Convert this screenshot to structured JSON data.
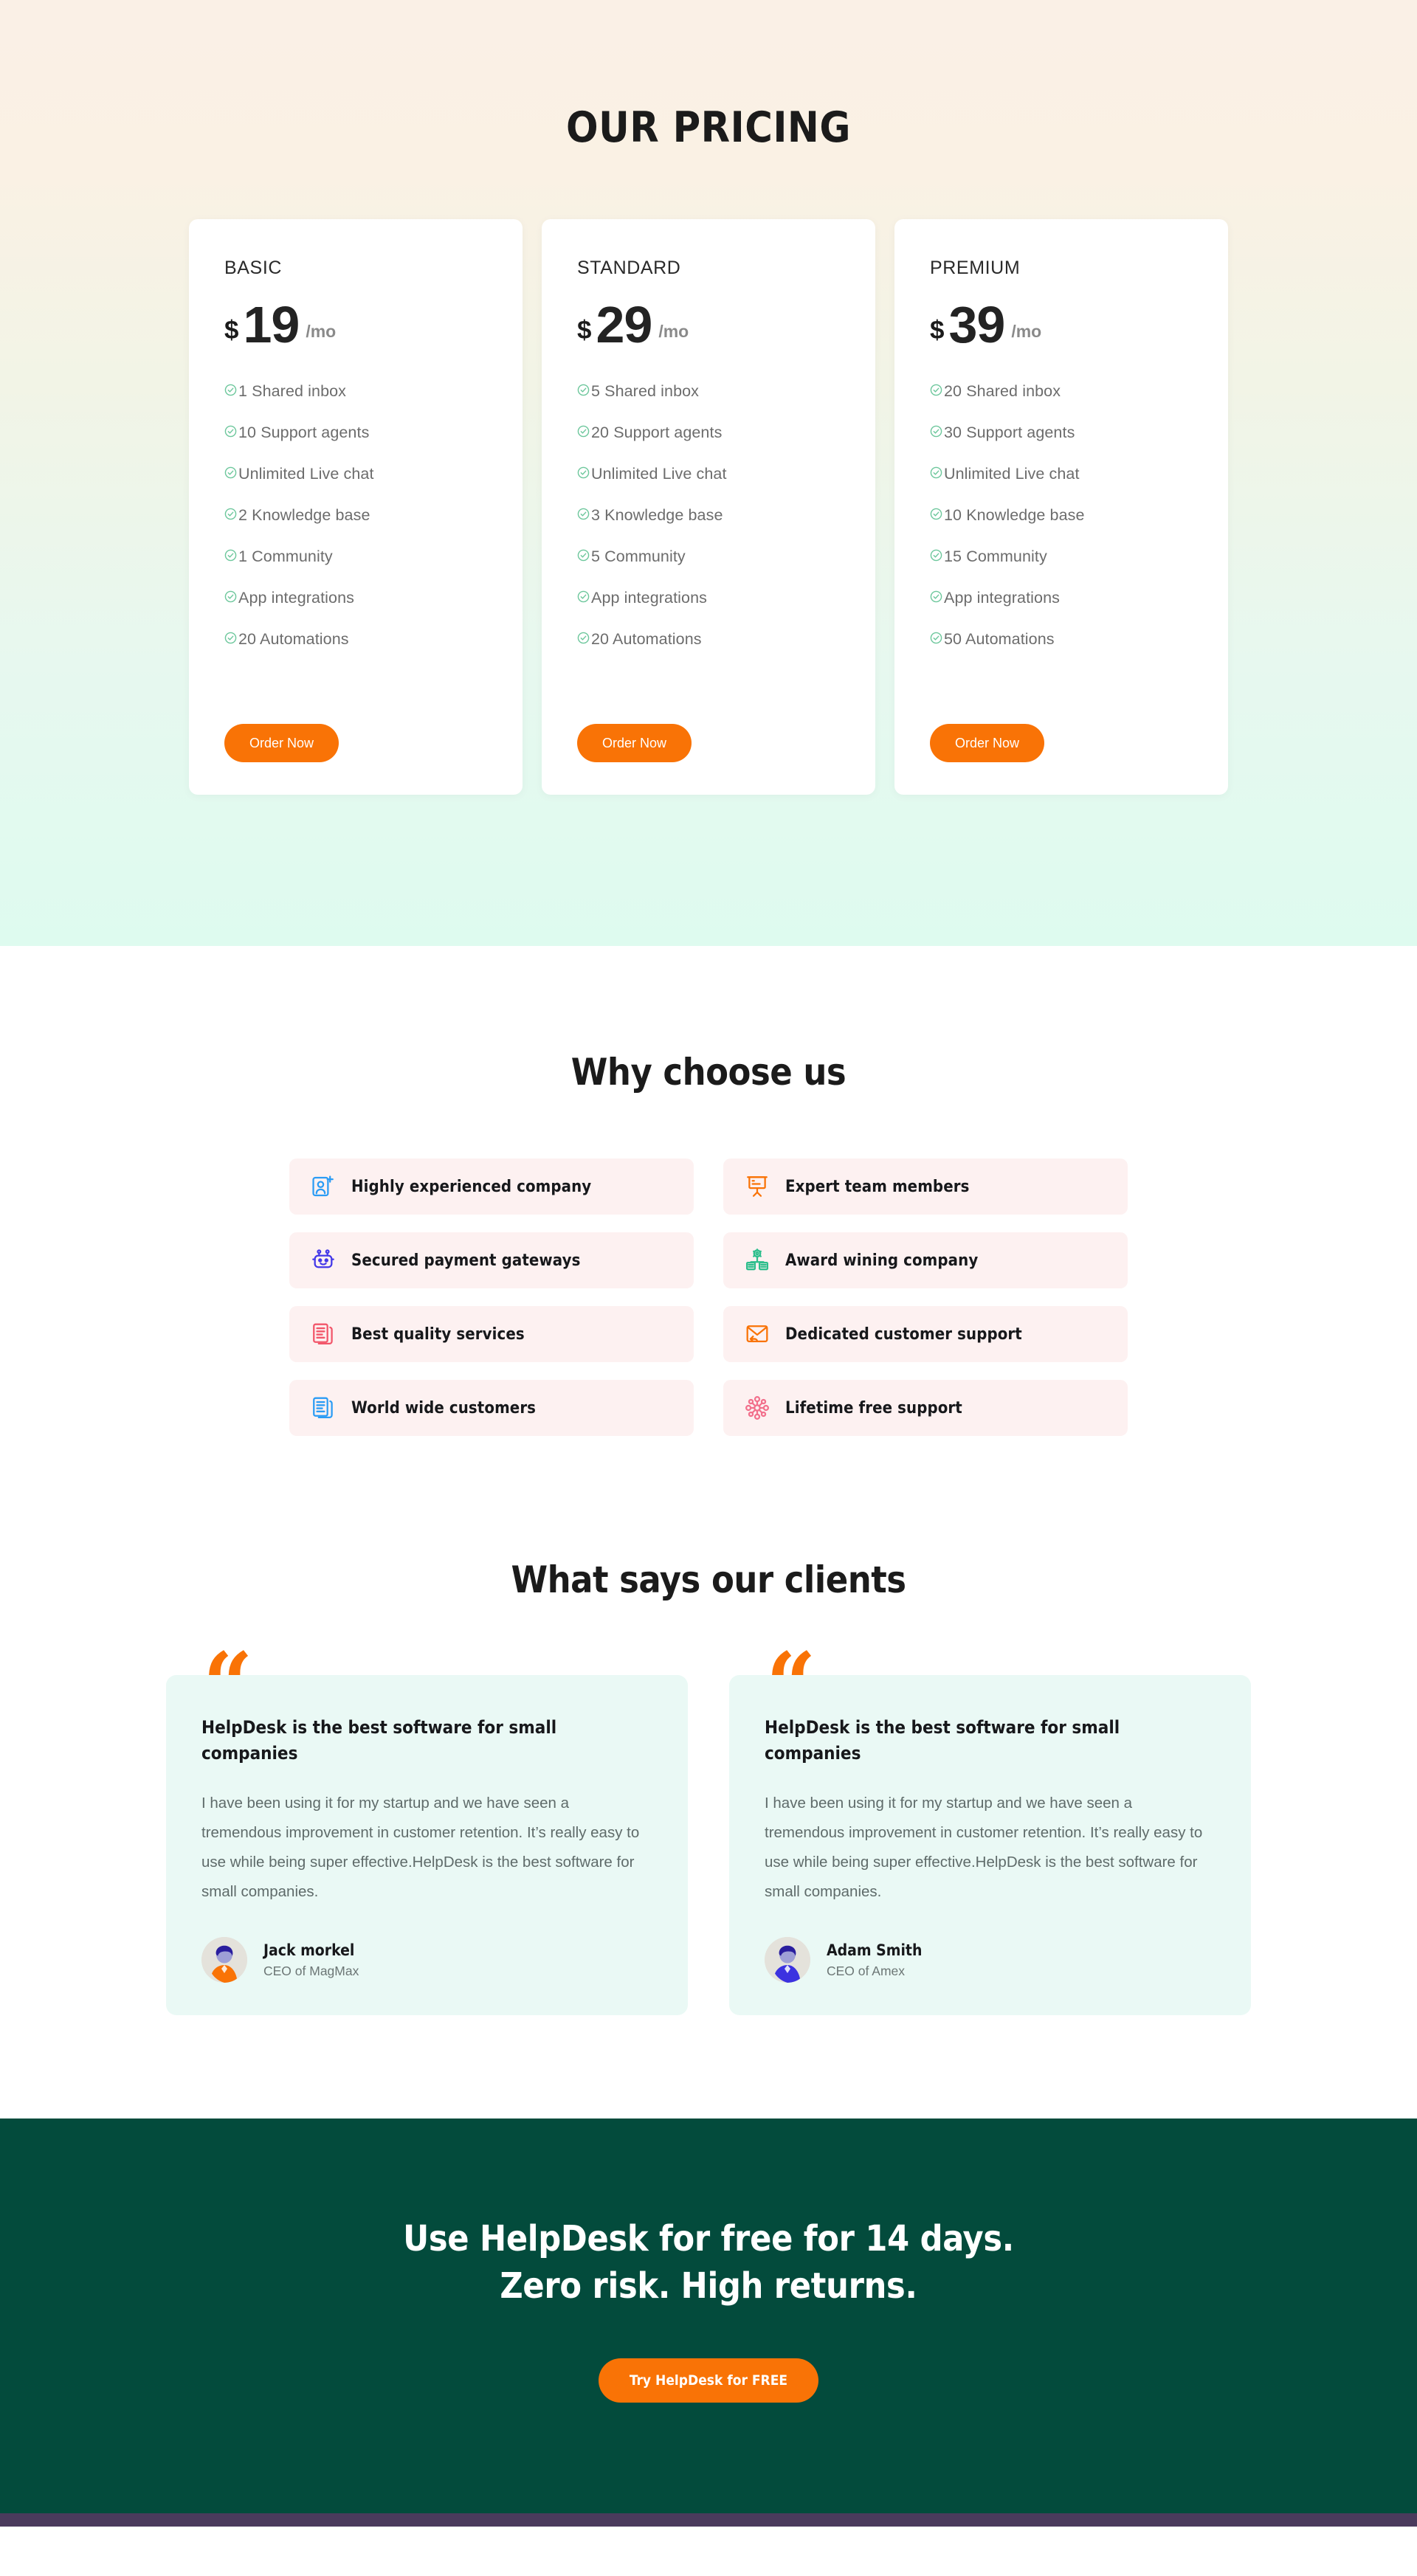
{
  "pricing": {
    "title": "OUR PRICING",
    "order_label": "Order Now",
    "per_month": "/mo",
    "currency": "$",
    "accent_color": "#F97306",
    "check_color": "#6DC79C",
    "plans": [
      {
        "name": "BASIC",
        "amount": "19",
        "features": [
          "1 Shared inbox",
          "10 Support agents",
          "Unlimited Live chat",
          " 2 Knowledge base",
          "1 Community",
          "App integrations",
          "20 Automations"
        ]
      },
      {
        "name": "STANDARD",
        "amount": "29",
        "features": [
          "5 Shared inbox",
          "20 Support agents",
          "Unlimited Live chat",
          " 3 Knowledge base",
          "5 Community",
          "App integrations",
          "20 Automations"
        ]
      },
      {
        "name": "PREMIUM",
        "amount": "39",
        "features": [
          "20 Shared inbox",
          "30 Support agents",
          "Unlimited Live chat",
          "10 Knowledge base",
          "15 Community",
          "App integrations",
          "50 Automations"
        ]
      }
    ]
  },
  "why": {
    "title": "Why choose us",
    "card_bg": "#FDF1F1",
    "items": [
      {
        "label": "Highly experienced company",
        "icon": "add-user-icon",
        "color": "#2B9CF5"
      },
      {
        "label": "Expert team members",
        "icon": "presentation-icon",
        "color": "#F97306"
      },
      {
        "label": "Secured payment gateways",
        "icon": "robot-icon",
        "color": "#4338E8"
      },
      {
        "label": "Award wining company",
        "icon": "gear-money-icon",
        "color": "#2DBE8C"
      },
      {
        "label": "Best quality services",
        "icon": "documents-icon",
        "color": "#F2566A"
      },
      {
        "label": "Dedicated customer support",
        "icon": "mail-reply-icon",
        "color": "#F97306"
      },
      {
        "label": "World wide customers",
        "icon": "documents-icon",
        "color": "#2B9CF5"
      },
      {
        "label": "Lifetime free support",
        "icon": "network-icon",
        "color": "#F2708C"
      }
    ]
  },
  "testimonials": {
    "title": "What says our clients",
    "quote_glyph": "“",
    "card_bg": "#EAF9F5",
    "items": [
      {
        "heading": "HelpDesk is the best software for small companies",
        "body": "I have been using it for my startup and we have seen a tremendous improvement in customer retention. It’s really easy to use while being super effective.HelpDesk is the best software for small companies.",
        "name": "Jack morkel",
        "role": "CEO of MagMax",
        "shirt_color": "#F97306",
        "hair_color": "#2A1E9E"
      },
      {
        "heading": "HelpDesk is the best software for small companies",
        "body": "I have been using it for my startup and we have seen a tremendous improvement in customer retention. It’s really easy to use while being super effective.HelpDesk is the best software for small companies.",
        "name": "Adam Smith",
        "role": "CEO of Amex",
        "shirt_color": "#3B32E0",
        "hair_color": "#2A1E9E"
      }
    ]
  },
  "cta": {
    "line1": "Use HelpDesk for free for 14 days.",
    "line2": "Zero risk. High returns.",
    "button": "Try HelpDesk for FREE",
    "bg_color": "#034B3C",
    "button_color": "#F97306"
  },
  "footer_strip_color": "#4A3A5C"
}
